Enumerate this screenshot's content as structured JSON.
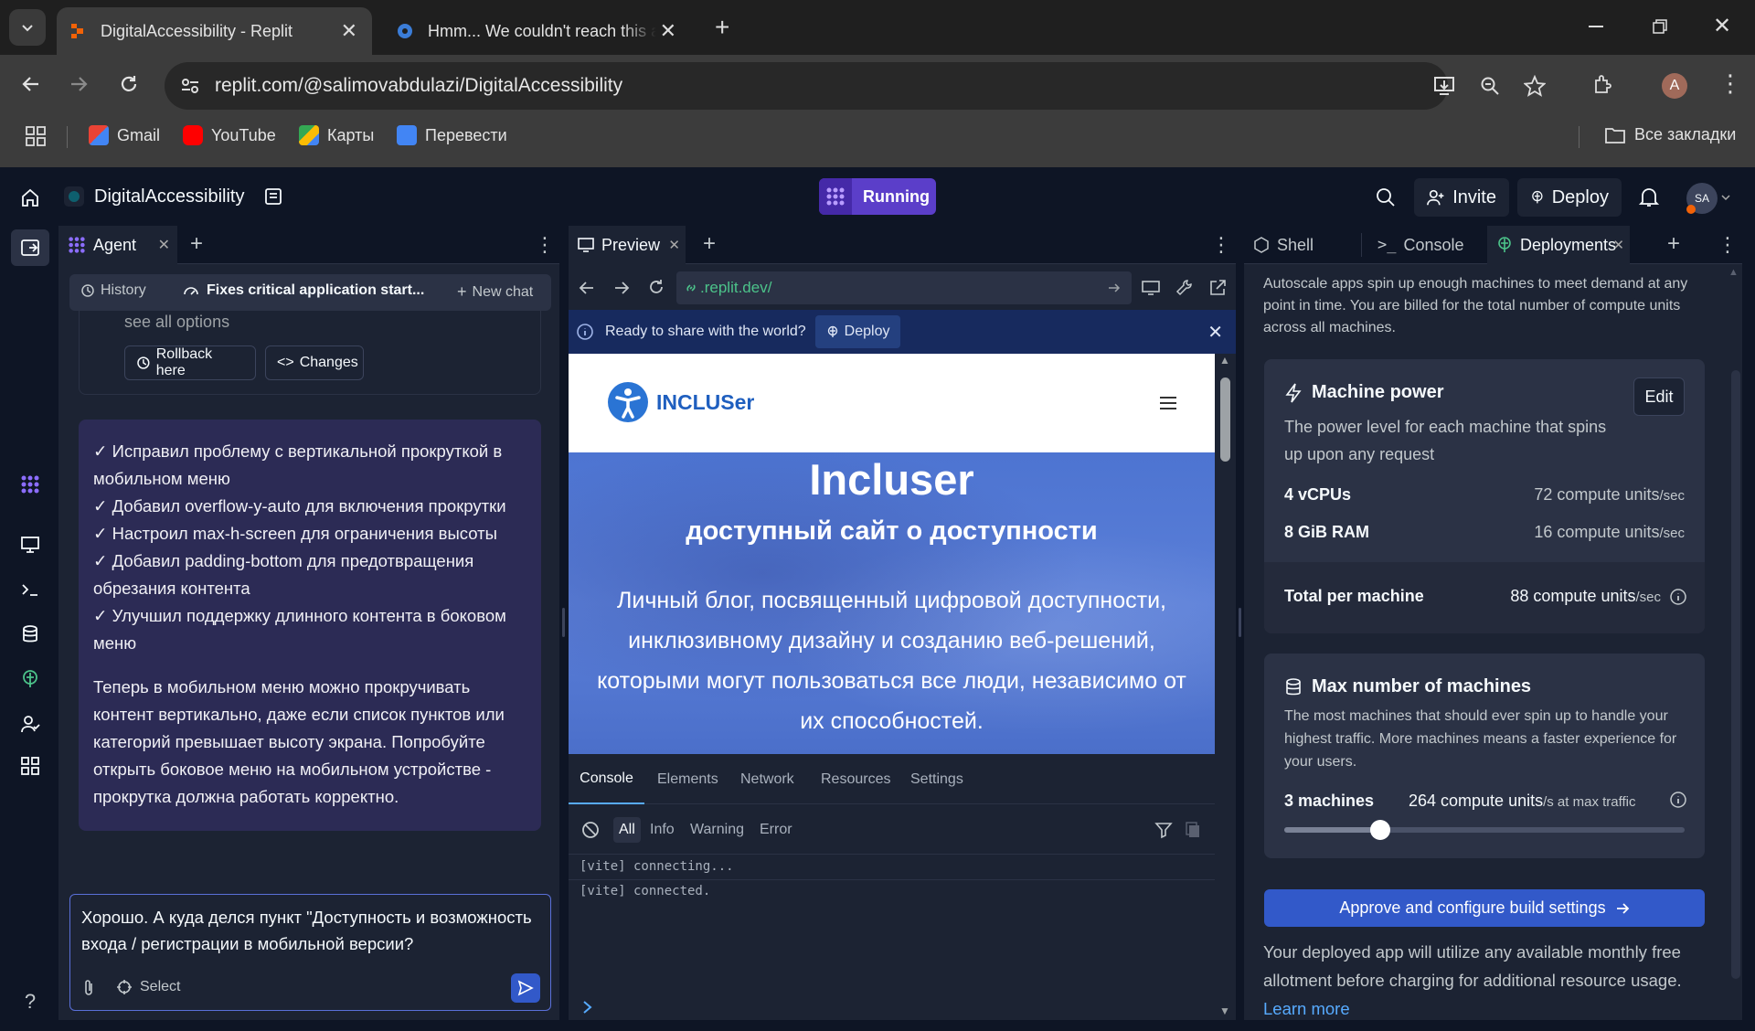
{
  "browser": {
    "tabs": [
      {
        "title": "DigitalAccessibility - Replit"
      },
      {
        "title": "Hmm... We couldn't reach this a"
      }
    ],
    "url": "replit.com/@salimovabdulazi/DigitalAccessibility",
    "profile_initial": "A",
    "bookmarks": [
      "Gmail",
      "YouTube",
      "Карты",
      "Перевести"
    ],
    "all_bookmarks": "Все закладки"
  },
  "header": {
    "project_name": "DigitalAccessibility",
    "run_status": "Running",
    "invite": "Invite",
    "deploy": "Deploy",
    "avatar_initials": "SA"
  },
  "agent": {
    "tab_label": "Agent",
    "history": "History",
    "thread_title": "Fixes critical application start...",
    "new_chat": "New chat",
    "see_all_options": "see all options",
    "rollback": "Rollback here",
    "changes": "Changes",
    "message_lines": [
      "✓ Исправил проблему с вертикальной прокруткой в мобильном меню",
      "✓ Добавил overflow-y-auto для включения прокрутки",
      "✓ Настроил max-h-screen для ограничения высоты",
      "✓ Добавил padding-bottom для предотвращения обрезания контента",
      "✓ Улучшил поддержку длинного контента в боковом меню"
    ],
    "message_summary": "Теперь в мобильном меню можно прокручивать контент вертикально, даже если список пунктов или категорий превышает высоту экрана. Попробуйте открыть боковое меню на мобильном устройстве - прокрутка должна работать корректно.",
    "composer_text": "Хорошо. А куда делся пункт \"Доступность и возможность входа / регистрации в мобильной версии?",
    "select": "Select"
  },
  "preview": {
    "tab_label": "Preview",
    "address": ".replit.dev/",
    "ready_text": "Ready to share with the world?",
    "ready_deploy": "Deploy",
    "site": {
      "logo": "INCLUSer",
      "title": "Incluser",
      "subtitle": "доступный сайт о доступности",
      "body": "Личный блог, посвященный цифровой доступности, инклюзивному дизайну и созданию веб-решений, которыми могут пользоваться все люди, независимо от их способностей."
    },
    "devtools_tabs": [
      "Console",
      "Elements",
      "Network",
      "Resources",
      "Settings"
    ],
    "filters": [
      "All",
      "Info",
      "Warning",
      "Error"
    ],
    "logs": [
      "[vite] connecting...",
      "[vite] connected."
    ]
  },
  "deployments": {
    "tabs": [
      "Shell",
      "Console",
      "Deployments"
    ],
    "intro": "Autoscale apps spin up enough machines to meet demand at any point in time. You are billed for the total number of compute units across all machines.",
    "machine_power": {
      "title": "Machine power",
      "edit": "Edit",
      "desc": "The power level for each machine that spins up upon any request",
      "vcpus_label": "4 vCPUs",
      "vcpus_value": "72 compute units",
      "ram_label": "8 GiB RAM",
      "ram_value": "16 compute units",
      "per_sec": "/sec",
      "total_label": "Total per machine",
      "total_value": "88 compute units"
    },
    "max_machines": {
      "title": "Max number of machines",
      "desc": "The most machines that should ever spin up to handle your highest traffic. More machines means a faster experience for your users.",
      "count": "3 machines",
      "units": "264 compute units",
      "units_suffix": "/s at max traffic",
      "slider_fraction": 0.24
    },
    "approve_button": "Approve and configure build settings",
    "footer_text": "Your deployed app will utilize any available monthly free allotment before charging for additional resource usage.",
    "learn_more": "Learn more"
  },
  "colors": {
    "accent": "#5b3ec9",
    "link": "#57abff",
    "approve": "#3259c9",
    "bg": "#0e1525",
    "surface": "#1c2333"
  }
}
